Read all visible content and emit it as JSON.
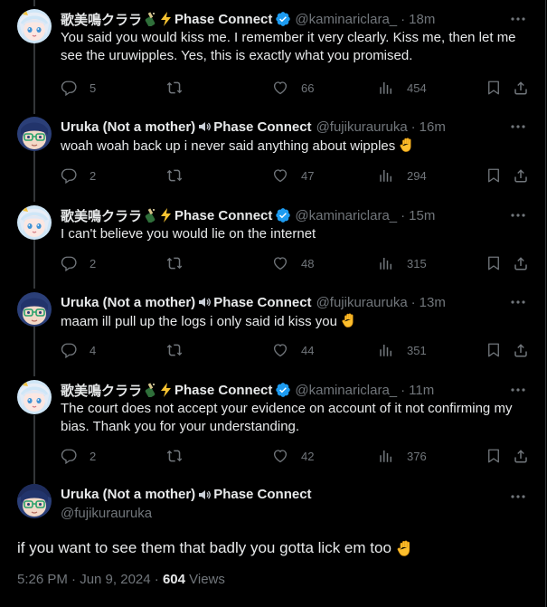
{
  "tweets": [
    {
      "display_name": "歌美鳴クララ",
      "name_emojis": "🍾⚡",
      "org": "Phase Connect",
      "verified": true,
      "handle": "@kaminariclara_",
      "time": "18m",
      "text": "You said you would kiss me. I remember it very clearly. Kiss me, then let me see the uruwipples. Yes, this is exactly what you promised.",
      "replies": "5",
      "reposts": "",
      "likes": "66",
      "views": "454",
      "avatar": "clara-avatar"
    },
    {
      "display_name": "Uruka (Not a mother)",
      "name_emojis": "🔊",
      "org": "Phase Connect",
      "verified": false,
      "handle": "@fujikurauruka",
      "time": "16m",
      "text": "woah woah back up i never said anything about wipples ✋",
      "replies": "2",
      "reposts": "",
      "likes": "47",
      "views": "294",
      "avatar": "uruka-avatar"
    },
    {
      "display_name": "歌美鳴クララ",
      "name_emojis": "🍾⚡",
      "org": "Phase Connect",
      "verified": true,
      "handle": "@kaminariclara_",
      "time": "15m",
      "text": "I can't believe you would lie on the internet",
      "replies": "2",
      "reposts": "",
      "likes": "48",
      "views": "315",
      "avatar": "clara-avatar"
    },
    {
      "display_name": "Uruka (Not a mother)",
      "name_emojis": "🔊",
      "org": "Phase Connect",
      "verified": false,
      "handle": "@fujikurauruka",
      "time": "13m",
      "text": "maam ill pull up the logs i only said id kiss you ✋",
      "replies": "4",
      "reposts": "",
      "likes": "44",
      "views": "351",
      "avatar": "uruka-avatar"
    },
    {
      "display_name": "歌美鳴クララ",
      "name_emojis": "🍾⚡",
      "org": "Phase Connect",
      "verified": true,
      "handle": "@kaminariclara_",
      "time": "11m",
      "text": "The court does not accept your evidence on account of it not confirming my bias. Thank you for your understanding.",
      "replies": "2",
      "reposts": "",
      "likes": "42",
      "views": "376",
      "avatar": "clara-avatar"
    }
  ],
  "main_tweet": {
    "display_name": "Uruka (Not a mother)",
    "name_emojis": "🔊",
    "org": "Phase Connect",
    "handle": "@fujikurauruka",
    "text": "if you want to see them that badly you gotta lick em too",
    "hand_emoji": "✋",
    "timestamp": "5:26 PM · Jun 9, 2024",
    "meta_sep": " · ",
    "view_count": "604",
    "views_label": "Views"
  },
  "colors": {
    "background": "#000000",
    "text_primary": "#e7e9ea",
    "text_secondary": "#71767b",
    "verified_blue": "#1d9bf0",
    "thread_line": "#333639"
  }
}
